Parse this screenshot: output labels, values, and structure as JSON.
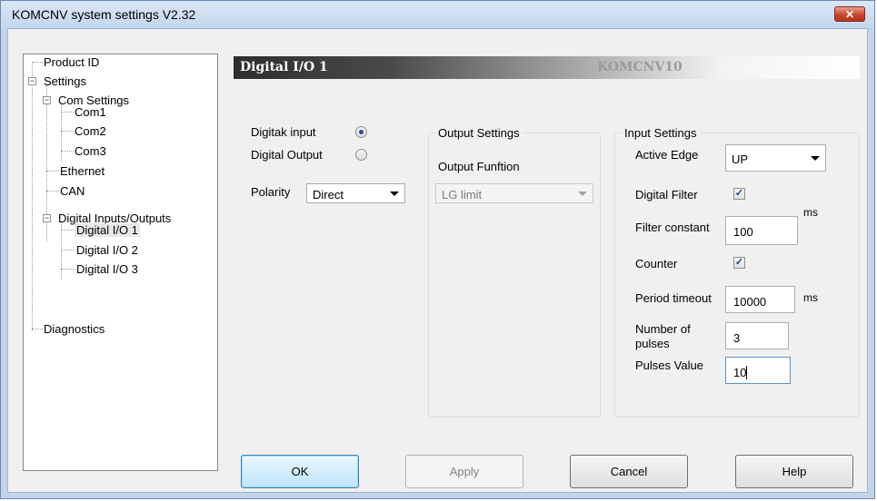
{
  "window": {
    "title": "KOMCNV system settings V2.32",
    "close_glyph": "✕"
  },
  "tree": {
    "product_id": "Product ID",
    "settings": "Settings",
    "com_settings": "Com Settings",
    "com1": "Com1",
    "com2": "Com2",
    "com3": "Com3",
    "ethernet": "Ethernet",
    "can": "CAN",
    "digital_io_group": "Digital Inputs/Outputs",
    "dio1": "Digital I/O 1",
    "dio2": "Digital I/O 2",
    "dio3": "Digital I/O 3",
    "diagnostics": "Diagnostics",
    "expander_glyph": "−"
  },
  "header": {
    "title": "Digital I/O 1",
    "model": "KOMCNV10"
  },
  "mode": {
    "digital_input_label": "Digitak input",
    "digital_output_label": "Digital Output",
    "selected": "input",
    "polarity_label": "Polarity",
    "polarity_value": "Direct"
  },
  "output_settings": {
    "legend": "Output Settings",
    "function_label": "Output Funftion",
    "function_value": "LG limit"
  },
  "input_settings": {
    "legend": "Input Settings",
    "active_edge_label": "Active Edge",
    "active_edge_value": "UP",
    "digital_filter_label": "Digital Filter",
    "digital_filter_checked": true,
    "filter_constant_label": "Filter constant",
    "filter_constant_value": "100",
    "filter_constant_unit": "ms",
    "counter_label": "Counter",
    "counter_checked": true,
    "period_timeout_label": "Period timeout",
    "period_timeout_value": "10000",
    "period_timeout_unit": "ms",
    "number_of_pulses_label_line1": "Number of",
    "number_of_pulses_label_line2": "pulses",
    "number_of_pulses_value": "3",
    "pulses_value_label": "Pulses Value",
    "pulses_value_value": "10"
  },
  "buttons": {
    "ok": "OK",
    "apply": "Apply",
    "cancel": "Cancel",
    "help": "Help"
  },
  "check_glyph": "✓"
}
